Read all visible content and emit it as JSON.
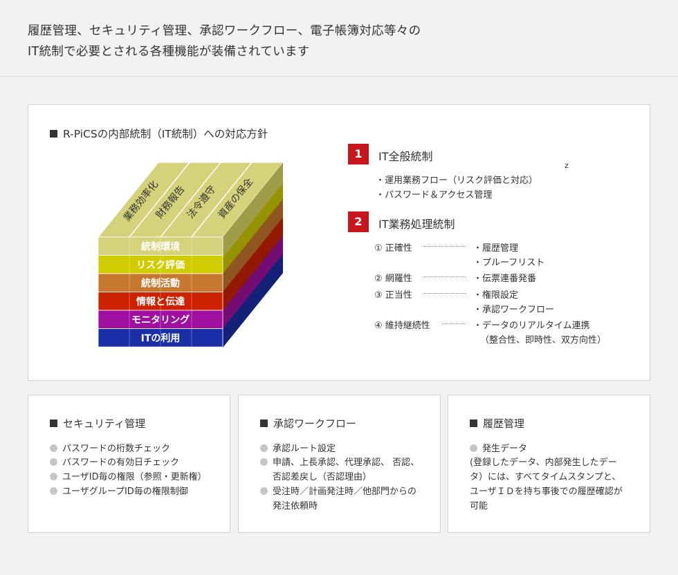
{
  "header": {
    "line1": "履歴管理、セキュリティ管理、承認ワークフロー、電子帳簿対応等々の",
    "line2": "IT統制で必要とされる各種機能が装備されています"
  },
  "main": {
    "title": "R-PiCSの内部統制（IT統制）への対応方針",
    "cube": {
      "top_labels": [
        "業務効率化",
        "財務報告",
        "法令遵守",
        "資産の保全"
      ],
      "layers": [
        {
          "label": "統制環境",
          "color": "#d4d27a"
        },
        {
          "label": "リスク評価",
          "color": "#d1cc00"
        },
        {
          "label": "統制活動",
          "color": "#c8782e"
        },
        {
          "label": "情報と伝達",
          "color": "#cc2200"
        },
        {
          "label": "モニタリング",
          "color": "#a010a0"
        },
        {
          "label": "ITの利用",
          "color": "#1a2ea8"
        }
      ]
    },
    "z_mark": "z",
    "section1": {
      "number": "1",
      "title": "IT全般統制",
      "items": [
        "・運用業務フロー（リスク評価と対応）",
        "・パスワード＆アクセス管理"
      ]
    },
    "section2": {
      "number": "2",
      "title": "IT業務処理統制",
      "rows": [
        {
          "label": "① 正確性",
          "items": [
            "・履歴管理",
            "・プルーフリスト"
          ]
        },
        {
          "label": "② 網羅性",
          "items": [
            "・伝票連番発番"
          ]
        },
        {
          "label": "③ 正当性",
          "items": [
            "・権限設定",
            "・承認ワークフロー"
          ]
        },
        {
          "label": "④ 維持継続性",
          "items": [
            "・データのリアルタイム連携",
            "（整合性、即時性、双方向性）"
          ]
        }
      ]
    }
  },
  "cards": [
    {
      "title": "セキュリティ管理",
      "bullets": [
        "パスワードの桁数チェック",
        "パスワードの有効日チェック",
        "ユーザID毎の権限（参照・更新権）",
        "ユーザグループID毎の権限制御"
      ]
    },
    {
      "title": "承認ワークフロー",
      "bullets": [
        "承認ルート設定",
        "申請、上長承認、代理承認、 否認、",
        "否認差戻し（否認理由）",
        "受注時／計画発注時／他部門からの",
        "発注依頼時"
      ]
    },
    {
      "title": "履歴管理",
      "bullets": [
        "発生データ",
        "(登録したデータ、内部発生したデー",
        "タ）には、すべてタイムスタンプと、",
        "ユーザＩＤを持ち事後での履歴確認が",
        "可能"
      ]
    }
  ]
}
